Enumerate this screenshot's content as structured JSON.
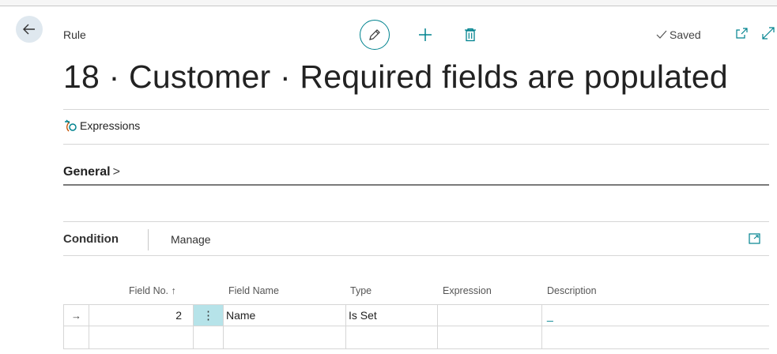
{
  "page": {
    "caption": "Rule",
    "title": "18 · Customer · Required fields are populated",
    "status": "Saved"
  },
  "actions": {
    "expressions_label": "Expressions"
  },
  "general": {
    "label": "General",
    "chevron": ">"
  },
  "part": {
    "tabs": [
      "Condition",
      "Manage"
    ]
  },
  "table": {
    "columns": {
      "field_no": "Field No. ↑",
      "field_name": "Field Name",
      "type": "Type",
      "expression": "Expression",
      "description": "Description"
    },
    "rows": [
      {
        "indicator": "→",
        "field_no": "2",
        "menu": "⋮",
        "field_name": "Name",
        "type": "Is Set",
        "expression": "",
        "description": "_"
      }
    ]
  },
  "colors": {
    "accent": "#00838f",
    "selected_cell": "#b6e3e9",
    "back_button_bg": "#dfe8ef"
  },
  "icons": [
    "back-arrow-icon",
    "pencil-icon",
    "plus-icon",
    "trash-icon",
    "checkmark-icon",
    "popout-icon",
    "expand-icon",
    "expressions-icon",
    "expand-part-icon"
  ]
}
